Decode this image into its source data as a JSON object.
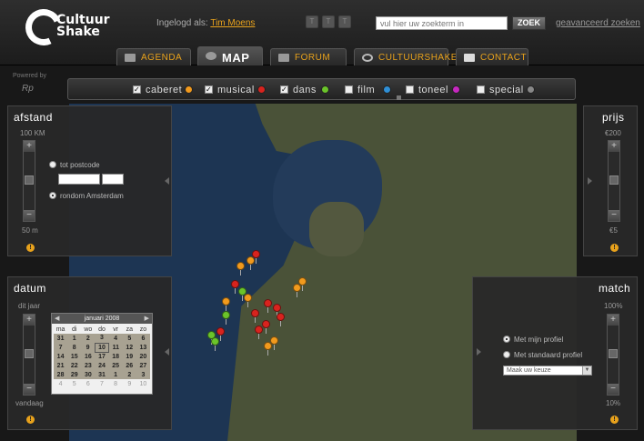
{
  "header": {
    "logo_text_1": "Cultuur",
    "logo_text_2": "Shake",
    "login_prefix": "Ingelogd als:",
    "user_name": "Tim Moens",
    "search_placeholder": "vul hier uw zoekterm in",
    "search_button": "ZOEK",
    "advanced_search": "geavanceerd zoeken"
  },
  "tabs": [
    {
      "label": "AGENDA"
    },
    {
      "label": "MAP"
    },
    {
      "label": "FORUM"
    },
    {
      "label": "CULTUURSHAKE"
    },
    {
      "label": "CONTACT"
    }
  ],
  "powered_by": "Powered by",
  "powered_logo": "Rp",
  "filters": [
    {
      "label": "caberet",
      "checked": true,
      "color": "#f29a1d"
    },
    {
      "label": "musical",
      "checked": true,
      "color": "#d8231e"
    },
    {
      "label": "dans",
      "checked": true,
      "color": "#6bc42a"
    },
    {
      "label": "film",
      "checked": false,
      "color": "#2f8fd6"
    },
    {
      "label": "toneel",
      "checked": false,
      "color": "#c628c0"
    },
    {
      "label": "special",
      "checked": false,
      "color": "#888888"
    }
  ],
  "afstand": {
    "title": "afstand",
    "max": "100 KM",
    "min": "50 m",
    "opt_postcode": "tot postcode",
    "opt_around": "rondom Amsterdam"
  },
  "prijs": {
    "title": "prijs",
    "max": "€200",
    "min": "€5"
  },
  "datum": {
    "title": "datum",
    "top": "dit jaar",
    "bottom": "vandaag",
    "calendar": {
      "month": "januari 2008",
      "days": [
        "ma",
        "di",
        "wo",
        "do",
        "vr",
        "za",
        "zo"
      ],
      "weeks": [
        [
          "31",
          "1",
          "2",
          "3",
          "4",
          "5",
          "6"
        ],
        [
          "7",
          "8",
          "9",
          "10",
          "11",
          "12",
          "13"
        ],
        [
          "14",
          "15",
          "16",
          "17",
          "18",
          "19",
          "20"
        ],
        [
          "21",
          "22",
          "23",
          "24",
          "25",
          "26",
          "27"
        ],
        [
          "28",
          "29",
          "30",
          "31",
          "1",
          "2",
          "3"
        ],
        [
          "4",
          "5",
          "6",
          "7",
          "8",
          "9",
          "10"
        ]
      ]
    }
  },
  "match": {
    "title": "match",
    "max": "100%",
    "min": "10%",
    "opt_profile": "Met mijn profiel",
    "opt_standard": "Met standaard profiel",
    "select_placeholder": "Maak uw keuze"
  }
}
